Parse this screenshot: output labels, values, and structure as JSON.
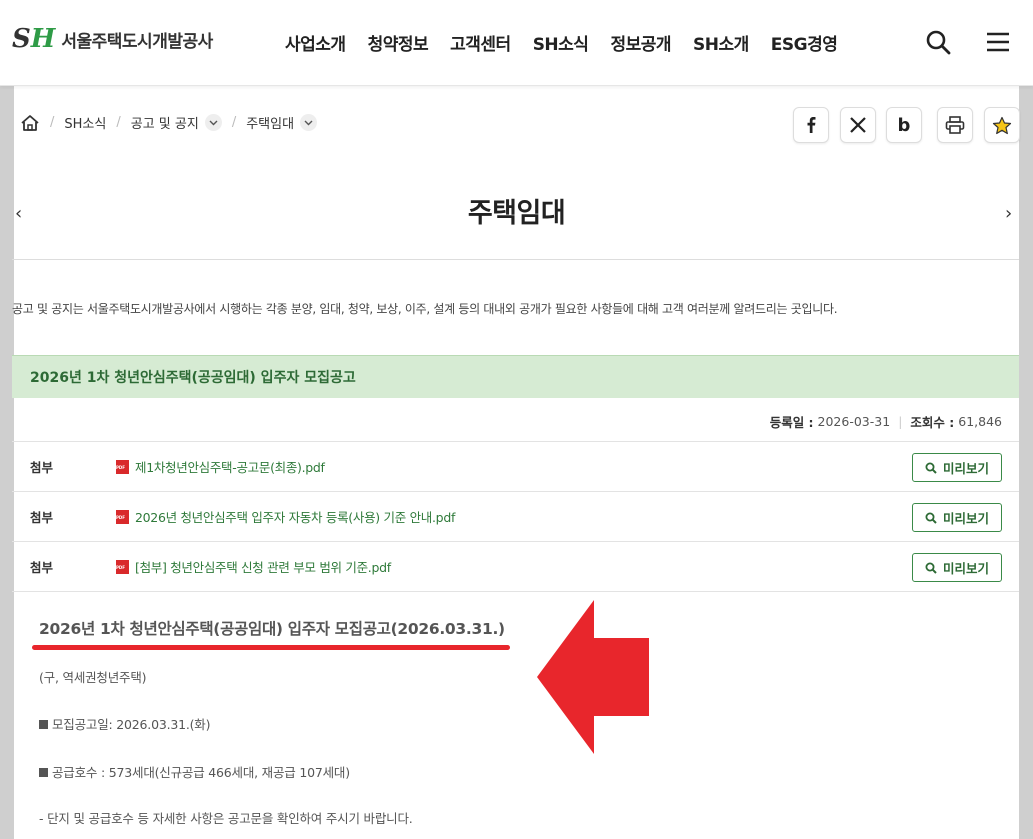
{
  "header": {
    "logo_mark_s": "S",
    "logo_mark_h": "H",
    "logo_text": "서울주택도시개발공사",
    "nav": [
      "사업소개",
      "청약정보",
      "고객센터",
      "SH소식",
      "정보공개",
      "SH소개",
      "ESG경영"
    ]
  },
  "breadcrumb": {
    "items": [
      "SH소식",
      "공고 및 공지",
      "주택임대"
    ]
  },
  "page": {
    "title": "주택임대",
    "prev_arrow": "‹",
    "next_arrow": "›",
    "intro": "공고 및 공지는 서울주택도시개발공사에서 시행하는 각종 분양, 임대, 청약, 보상, 이주, 설계 등의 대내외 공개가 필요한 사항들에 대해 고객 여러분께 알려드리는 곳입니다."
  },
  "notice": {
    "title": "2026년 1차 청년안심주택(공공임대) 입주자 모집공고",
    "reg_label": "등록일 :",
    "reg_date": "2026-03-31",
    "views_label": "조회수 :",
    "views": "61,846"
  },
  "attachments": [
    {
      "label": "첨부",
      "file": "제1차청년안심주택-공고문(최종).pdf",
      "button": "미리보기"
    },
    {
      "label": "첨부",
      "file": "2026년 청년안심주택 입주자 자동차 등록(사용) 기준 안내.pdf",
      "button": "미리보기"
    },
    {
      "label": "첨부",
      "file": "[첨부] 청년안심주택 신청 관련 부모 범위 기준.pdf",
      "button": "미리보기"
    }
  ],
  "body": {
    "title": "2026년 1차 청년안심주택(공공임대) 입주자 모집공고(2026.03.31.)",
    "line1": "(구, 역세권청년주택)",
    "line2": "모집공고일: 2026.03.31.(화)",
    "line3": "공급호수 : 573세대(신규공급 466세대, 재공급 107세대)",
    "line4": "- 단지 및 공급호수 등 자세한 사항은 공고문을 확인하여 주시기 바랍니다."
  },
  "colors": {
    "brand_green": "#2e9b46",
    "notice_bg": "#d6ebd3",
    "annotation_red": "#e8262c"
  }
}
